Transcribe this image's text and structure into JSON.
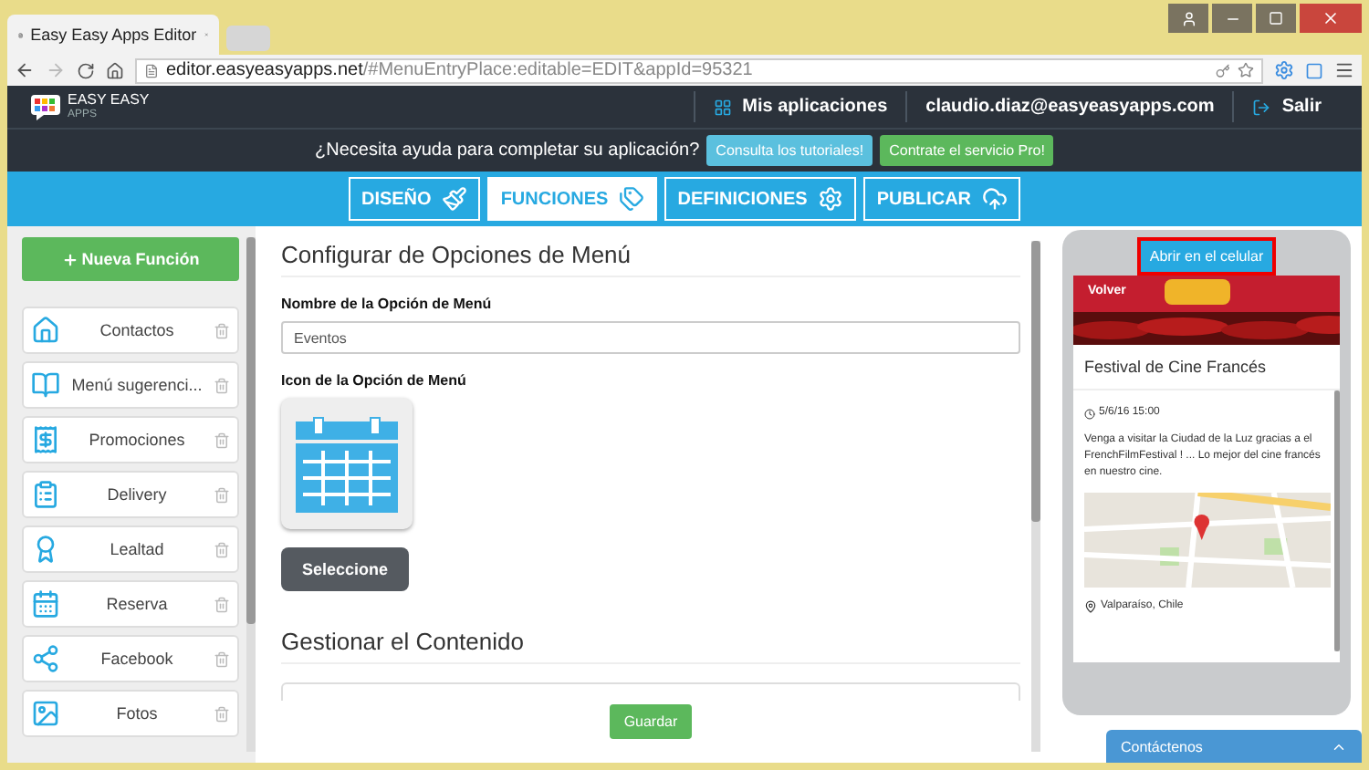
{
  "browser": {
    "tab_title": "Easy Easy Apps Editor",
    "url_host": "editor.easyeasyapps.net",
    "url_rest": "/#MenuEntryPlace:editable=EDIT&appId=95321"
  },
  "header": {
    "logo_line1": "EASY EASY",
    "logo_line2": "APPS",
    "apps": "Mis aplicaciones",
    "user": "claudio.diaz@easyeasyapps.com",
    "logout": "Salir"
  },
  "help_bar": {
    "question": "¿Necesita ayuda para completar su aplicación?",
    "tutorials": "Consulta los tutoriales!",
    "pro": "Contrate el servicio Pro!"
  },
  "nav_tabs": [
    {
      "label": "DISEÑO",
      "selected": false
    },
    {
      "label": "FUNCIONES",
      "selected": true
    },
    {
      "label": "DEFINICIONES",
      "selected": false
    },
    {
      "label": "PUBLICAR",
      "selected": false
    }
  ],
  "sidebar": {
    "new_button": "Nueva Función",
    "items": [
      {
        "label": "Contactos"
      },
      {
        "label": "Menú sugerenci..."
      },
      {
        "label": "Promociones"
      },
      {
        "label": "Delivery"
      },
      {
        "label": "Lealtad"
      },
      {
        "label": "Reserva"
      },
      {
        "label": "Facebook"
      },
      {
        "label": "Fotos"
      }
    ]
  },
  "form": {
    "title": "Configurar de Opciones de Menú",
    "name_label": "Nombre de la Opción de Menú",
    "name_value": "Eventos",
    "icon_label": "Icon de la Opción de Menú",
    "select_button": "Seleccione",
    "content_title": "Gestionar el Contenido",
    "save_button": "Guardar"
  },
  "preview": {
    "open_button": "Abrir en el celular",
    "back": "Volver",
    "event_title": "Festival de Cine Francés",
    "datetime": "5/6/16 15:00",
    "description": "Venga a visitar la Ciudad de la Luz gracias a el FrenchFilmFestival ! ... Lo mejor del cine francés en nuestro cine.",
    "location": "Valparaíso, Chile"
  },
  "contact_tab": "Contáctenos"
}
